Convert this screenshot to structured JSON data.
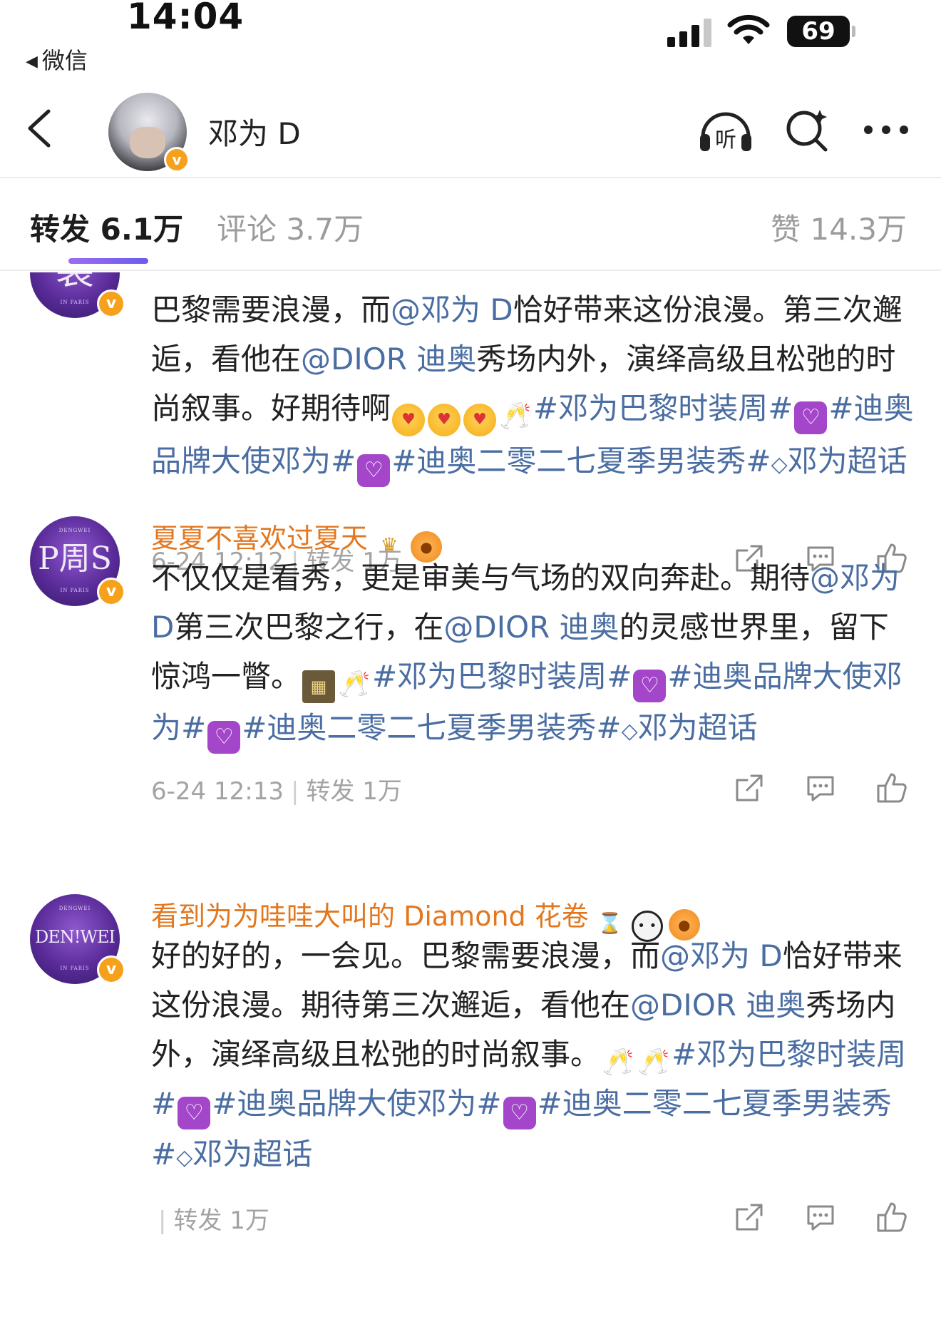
{
  "status_bar": {
    "time": "14:04",
    "back_app": "微信",
    "battery": "69"
  },
  "header": {
    "name": "邓为 D",
    "icons": [
      "back-icon",
      "listen-icon",
      "search-icon",
      "more-icon"
    ],
    "listen_label": "听"
  },
  "tabs": {
    "repost": "转发 6.1万",
    "comment": "评论 3.7万",
    "like": "赞 14.3万"
  },
  "reposts": [
    {
      "avatar_mark": "裘",
      "avatar_small_top": "",
      "avatar_small_bottom": "IN PARIS",
      "username": "",
      "content": {
        "t1": "巴黎需要浪漫，而",
        "m1": "@邓为 D",
        "t2": "恰好带来这份浪漫。第三次邂逅，看他在",
        "m2": "@DIOR 迪奥",
        "t3": "秀场内外，演绎高级且松弛的时尚叙事。好期待啊",
        "tag1": "#邓为巴黎时装周#",
        "tag2": "#迪奥品牌大使邓为#",
        "tag3": "#迪奥二零二七夏季男装秀#",
        "tag4": "邓为超话"
      },
      "time": "6-24 12:12",
      "repost": "转发 1万"
    },
    {
      "avatar_mark": "P周S",
      "avatar_small_top": "DENGWEI",
      "avatar_small_bottom": "IN PARIS",
      "username": "夏夏不喜欢过夏天",
      "content": {
        "t1": "不仅仅是看秀，更是审美与气场的双向奔赴。期待",
        "m1": "@邓为 D",
        "t2": "第三次巴黎之行，在",
        "m2": "@DIOR 迪奥",
        "t3": "的灵感世界里，留下惊鸿一瞥。",
        "tag1": "#邓为巴黎时装周#",
        "tag2": "#迪奥品牌大使邓为#",
        "tag3": "#迪奥二零二七夏季男装秀#",
        "tag4": "邓为超话"
      },
      "time": "6-24 12:13",
      "repost": "转发 1万"
    },
    {
      "avatar_mark": "DEN!WEI",
      "avatar_small_top": "DENGWEI",
      "avatar_small_bottom": "IN PARIS",
      "username": "看到为为哇哇大叫的 Diamond 花卷",
      "content": {
        "t1": "好的好的，一会见。巴黎需要浪漫，而",
        "m1": "@邓为 D",
        "t2": "恰好带来这份浪漫。期待第三次邂逅，看他在",
        "m2": "@DIOR 迪奥",
        "t3": "秀场内外，演绎高级且松弛的时尚叙事。",
        "tag1": "#邓为巴黎时装周#",
        "tag2": "#迪奥品牌大使邓为#",
        "tag3": "#迪奥二零二七夏季男装秀#",
        "tag4": "邓为超话"
      },
      "time": "",
      "repost": "转发 1万"
    }
  ],
  "colors": {
    "accent_underline": "#7d63f0",
    "username": "#e2771f",
    "link": "#4a6da2",
    "verified_badge": "#f6a11c",
    "muted": "#a3a3a3"
  }
}
